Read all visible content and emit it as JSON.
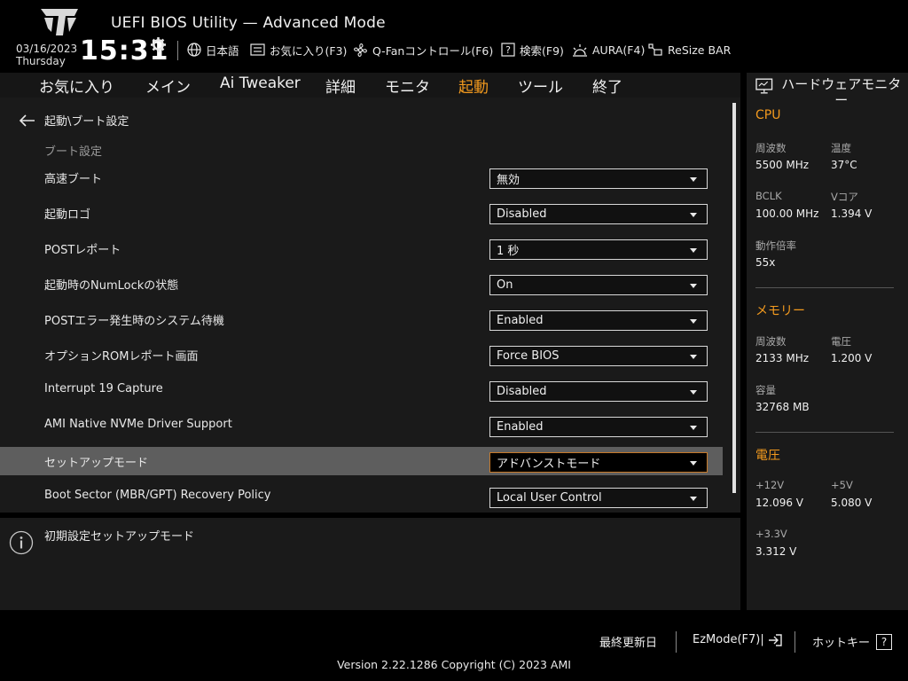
{
  "header": {
    "title": "UEFI BIOS Utility — Advanced Mode",
    "date": "03/16/2023",
    "weekday": "Thursday",
    "time": "15:31",
    "buttons": {
      "language": "日本語",
      "favorites": "お気に入り(F3)",
      "qfan": "Q-Fanコントロール(F6)",
      "search": "検索(F9)",
      "aura": "AURA(F4)",
      "resizebar": "ReSize BAR"
    }
  },
  "nav": {
    "tabs": [
      "お気に入り",
      "メイン",
      "Ai Tweaker",
      "詳細",
      "モニタ",
      "起動",
      "ツール",
      "終了"
    ],
    "active": "起動"
  },
  "main": {
    "breadcrumb": "起動\\ブート設定",
    "section": "ブート設定",
    "rows": [
      {
        "label": "高速ブート",
        "value": "無効"
      },
      {
        "label": "起動ロゴ",
        "value": "Disabled"
      },
      {
        "label": "POSTレポート",
        "value": "1 秒"
      },
      {
        "label": "起動時のNumLockの状態",
        "value": "On"
      },
      {
        "label": "POSTエラー発生時のシステム待機",
        "value": "Enabled"
      },
      {
        "label": "オプションROMレポート画面",
        "value": "Force BIOS"
      },
      {
        "label": "Interrupt 19 Capture",
        "value": "Disabled"
      },
      {
        "label": "AMI Native NVMe Driver Support",
        "value": "Enabled"
      },
      {
        "label": "セットアップモード",
        "value": "アドバンストモード"
      },
      {
        "label": "Boot Sector (MBR/GPT) Recovery Policy",
        "value": "Local User Control"
      }
    ]
  },
  "help": {
    "text": "初期設定セットアップモード"
  },
  "hw_monitor": {
    "title": "ハードウェアモニター",
    "cpu": {
      "heading": "CPU",
      "freq_label": "周波数",
      "freq": "5500 MHz",
      "temp_label": "温度",
      "temp": "37°C",
      "bclk_label": "BCLK",
      "bclk": "100.00 MHz",
      "vcore_label": "Vコア",
      "vcore": "1.394 V",
      "ratio_label": "動作倍率",
      "ratio": "55x"
    },
    "memory": {
      "heading": "メモリー",
      "freq_label": "周波数",
      "freq": "2133 MHz",
      "volt_label": "電圧",
      "volt": "1.200 V",
      "cap_label": "容量",
      "cap": "32768 MB"
    },
    "voltage": {
      "heading": "電圧",
      "v12_label": "+12V",
      "v12": "12.096 V",
      "v5_label": "+5V",
      "v5": "5.080 V",
      "v33_label": "+3.3V",
      "v33": "3.312 V"
    }
  },
  "footer": {
    "last_modified": "最終更新日",
    "ezmode": "EzMode(F7)|",
    "hotkeys": "ホットキー",
    "hotkey_badge": "?",
    "version": "Version 2.22.1286 Copyright (C) 2023 AMI"
  },
  "colors": {
    "accent": "#f39a1e",
    "panel": "#1a1a1a",
    "selected_row": "#5e5e5e"
  }
}
